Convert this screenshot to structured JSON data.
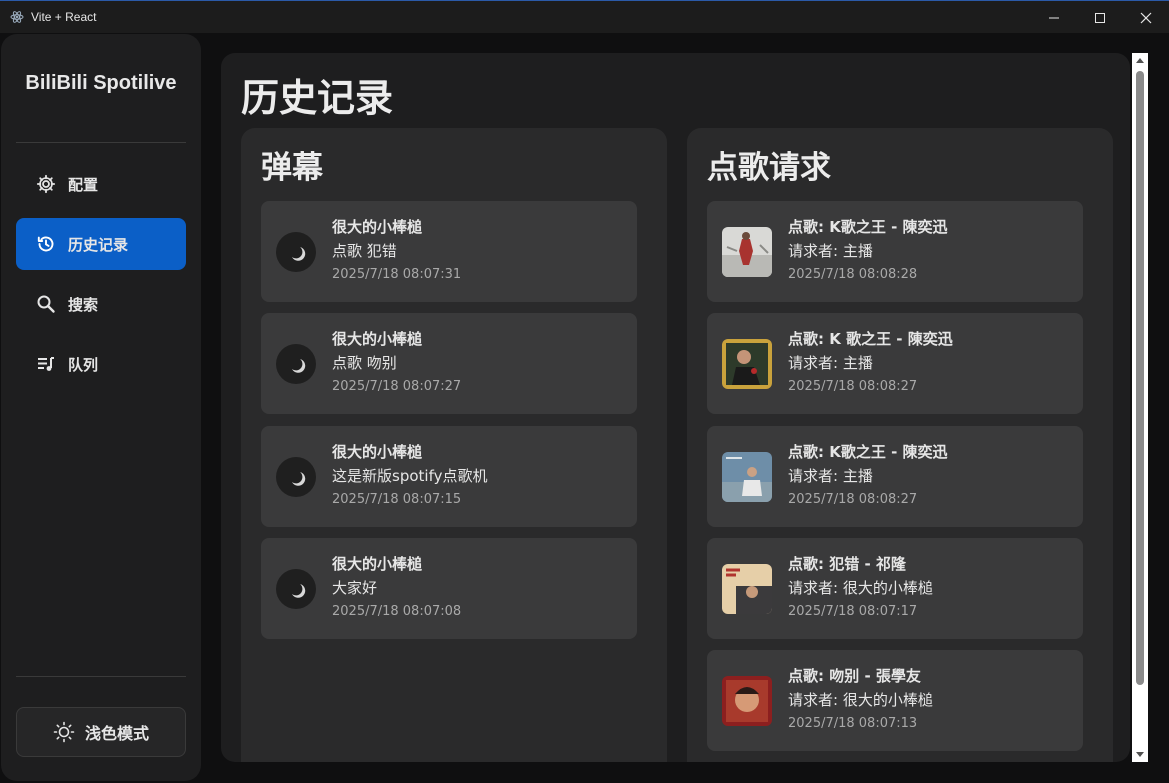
{
  "window": {
    "title": "Vite + React"
  },
  "sidebar": {
    "brand": "BiliBili Spotilive",
    "items": [
      {
        "label": "配置",
        "icon": "gear-icon"
      },
      {
        "label": "历史记录",
        "icon": "history-icon",
        "active": true
      },
      {
        "label": "搜索",
        "icon": "search-icon"
      },
      {
        "label": "队列",
        "icon": "queue-icon"
      }
    ],
    "theme_button": "浅色模式"
  },
  "main": {
    "title": "历史记录",
    "danmaku": {
      "title": "弹幕",
      "items": [
        {
          "user": "很大的小棒槌",
          "message": "点歌 犯错",
          "time": "2025/7/18 08:07:31"
        },
        {
          "user": "很大的小棒槌",
          "message": "点歌 吻别",
          "time": "2025/7/18 08:07:27"
        },
        {
          "user": "很大的小棒槌",
          "message": "这是新版spotify点歌机",
          "time": "2025/7/18 08:07:15"
        },
        {
          "user": "很大的小棒槌",
          "message": "大家好",
          "time": "2025/7/18 08:07:08"
        }
      ]
    },
    "requests": {
      "title": "点歌请求",
      "items": [
        {
          "song": "点歌: K歌之王 - 陳奕迅",
          "requester": "请求者: 主播",
          "time": "2025/7/18 08:08:28"
        },
        {
          "song": "点歌: K 歌之王 - 陳奕迅",
          "requester": "请求者: 主播",
          "time": "2025/7/18 08:08:27"
        },
        {
          "song": "点歌: K歌之王 - 陳奕迅",
          "requester": "请求者: 主播",
          "time": "2025/7/18 08:08:27"
        },
        {
          "song": "点歌: 犯错 - 祁隆",
          "requester": "请求者: 很大的小棒槌",
          "time": "2025/7/18 08:07:17"
        },
        {
          "song": "点歌: 吻别 - 張學友",
          "requester": "请求者: 很大的小棒槌",
          "time": "2025/7/18 08:07:13"
        }
      ]
    }
  },
  "colors": {
    "accent": "#0b5fc7",
    "background": "#0f0f10",
    "panel": "#2a2a2b",
    "card": "#3a3a3b"
  }
}
